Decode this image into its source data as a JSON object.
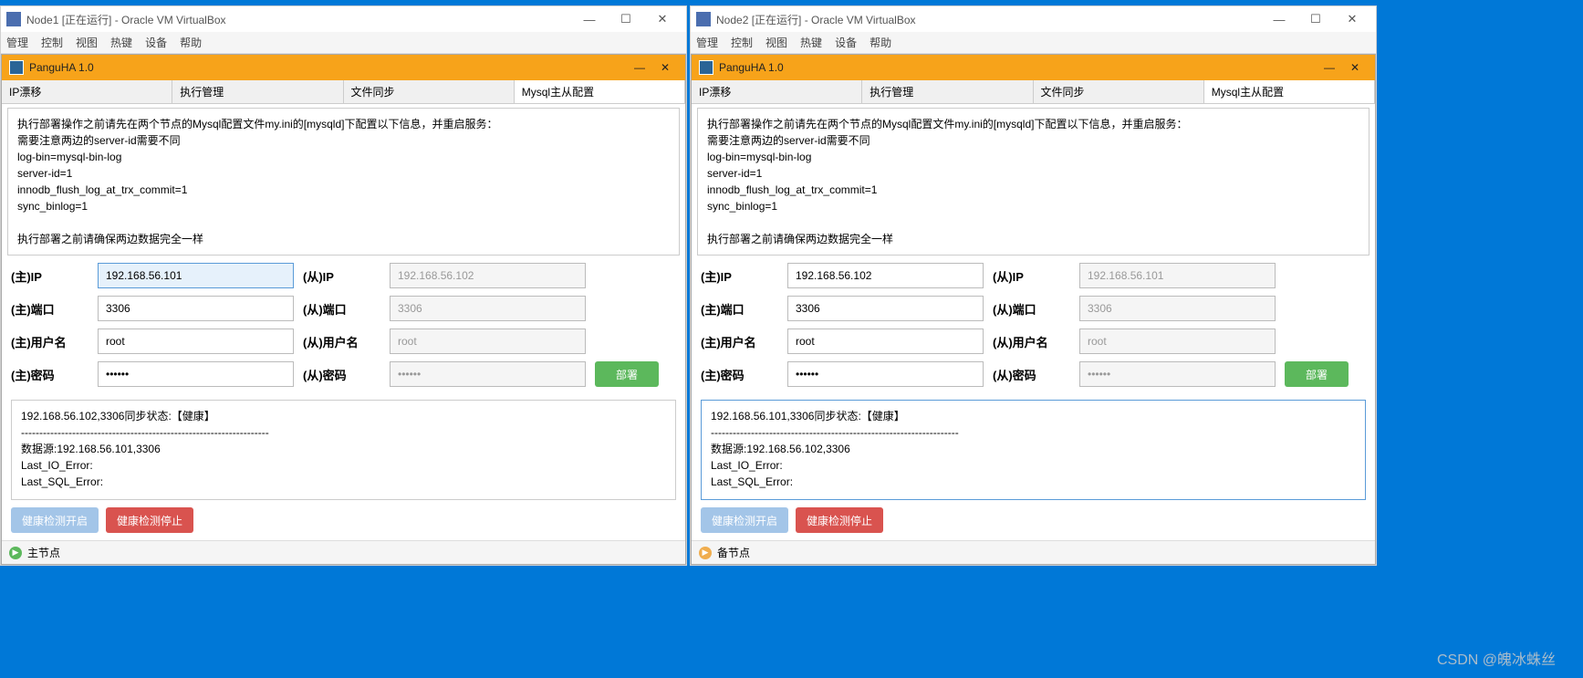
{
  "windows": {
    "left": {
      "vb_title": "Node1 [正在运行] - Oracle VM VirtualBox",
      "menu": [
        "管理",
        "控制",
        "视图",
        "热键",
        "设备",
        "帮助"
      ],
      "inner_title": "PanguHA 1.0",
      "tabs": [
        "IP漂移",
        "执行管理",
        "文件同步",
        "Mysql主从配置"
      ],
      "info_lines": [
        "执行部署操作之前请先在两个节点的Mysql配置文件my.ini的[mysqld]下配置以下信息，并重启服务：",
        "需要注意两边的server-id需要不同",
        "log-bin=mysql-bin-log",
        "server-id=1",
        "innodb_flush_log_at_trx_commit=1",
        "sync_binlog=1",
        "",
        "执行部署之前请确保两边数据完全一样"
      ],
      "labels": {
        "master_ip": "(主)IP",
        "slave_ip": "(从)IP",
        "master_port": "(主)端口",
        "slave_port": "(从)端口",
        "master_user": "(主)用户名",
        "slave_user": "(从)用户名",
        "master_pwd": "(主)密码",
        "slave_pwd": "(从)密码"
      },
      "form": {
        "master_ip": "192.168.56.101",
        "slave_ip": "192.168.56.102",
        "master_port": "3306",
        "slave_port": "3306",
        "master_user": "root",
        "slave_user": "root",
        "master_pwd": "••••••",
        "slave_pwd": "••••••"
      },
      "deploy": "部署",
      "status_lines": [
        "192.168.56.102,3306同步状态:【健康】",
        "--------------------------------------------------------------------",
        "数据源:192.168.56.101,3306",
        "Last_IO_Error:",
        "Last_SQL_Error:"
      ],
      "btn_start": "健康检测开启",
      "btn_stop": "健康检测停止",
      "footer": "主节点"
    },
    "right": {
      "vb_title": "Node2 [正在运行] - Oracle VM VirtualBox",
      "menu": [
        "管理",
        "控制",
        "视图",
        "热键",
        "设备",
        "帮助"
      ],
      "inner_title": "PanguHA 1.0",
      "tabs": [
        "IP漂移",
        "执行管理",
        "文件同步",
        "Mysql主从配置"
      ],
      "info_lines": [
        "执行部署操作之前请先在两个节点的Mysql配置文件my.ini的[mysqld]下配置以下信息，并重启服务：",
        "需要注意两边的server-id需要不同",
        "log-bin=mysql-bin-log",
        "server-id=1",
        "innodb_flush_log_at_trx_commit=1",
        "sync_binlog=1",
        "",
        "执行部署之前请确保两边数据完全一样"
      ],
      "labels": {
        "master_ip": "(主)IP",
        "slave_ip": "(从)IP",
        "master_port": "(主)端口",
        "slave_port": "(从)端口",
        "master_user": "(主)用户名",
        "slave_user": "(从)用户名",
        "master_pwd": "(主)密码",
        "slave_pwd": "(从)密码"
      },
      "form": {
        "master_ip": "192.168.56.102",
        "slave_ip": "192.168.56.101",
        "master_port": "3306",
        "slave_port": "3306",
        "master_user": "root",
        "slave_user": "root",
        "master_pwd": "••••••",
        "slave_pwd": "••••••"
      },
      "deploy": "部署",
      "status_lines": [
        "192.168.56.101,3306同步状态:【健康】",
        "--------------------------------------------------------------------",
        "数据源:192.168.56.102,3306",
        "Last_IO_Error:",
        "Last_SQL_Error:"
      ],
      "btn_start": "健康检测开启",
      "btn_stop": "健康检测停止",
      "footer": "备节点"
    }
  },
  "watermark": "CSDN @魄冰蛛丝"
}
